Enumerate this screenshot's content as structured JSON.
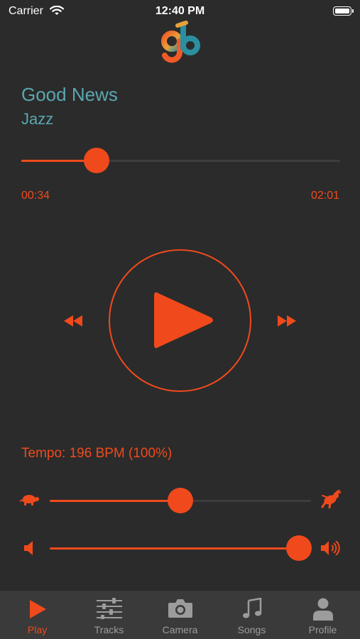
{
  "status_bar": {
    "carrier": "Carrier",
    "time": "12:40 PM"
  },
  "logo": {
    "text": "gb"
  },
  "song": {
    "title": "Good News",
    "genre": "Jazz"
  },
  "playback": {
    "elapsed": "00:34",
    "duration": "02:01",
    "progress": 0.235
  },
  "controls": {
    "rewind_icon": "rewind-icon",
    "play_icon": "play-icon",
    "forward_icon": "fast-forward-icon"
  },
  "tempo": {
    "label": "Tempo: 196 BPM (100%)",
    "level": 0.5
  },
  "volume": {
    "level": 0.955
  },
  "tabs": [
    {
      "label": "Play",
      "icon": "play-icon",
      "active": true
    },
    {
      "label": "Tracks",
      "icon": "sliders-icon",
      "active": false
    },
    {
      "label": "Camera",
      "icon": "camera-icon",
      "active": false
    },
    {
      "label": "Songs",
      "icon": "music-note-icon",
      "active": false
    },
    {
      "label": "Profile",
      "icon": "person-icon",
      "active": false
    }
  ],
  "colors": {
    "accent": "#f04a1c",
    "title": "#5aa7b0",
    "background": "#2b2b2b",
    "tabbar": "#3a3a3a",
    "inactive": "#9c9c9c"
  }
}
